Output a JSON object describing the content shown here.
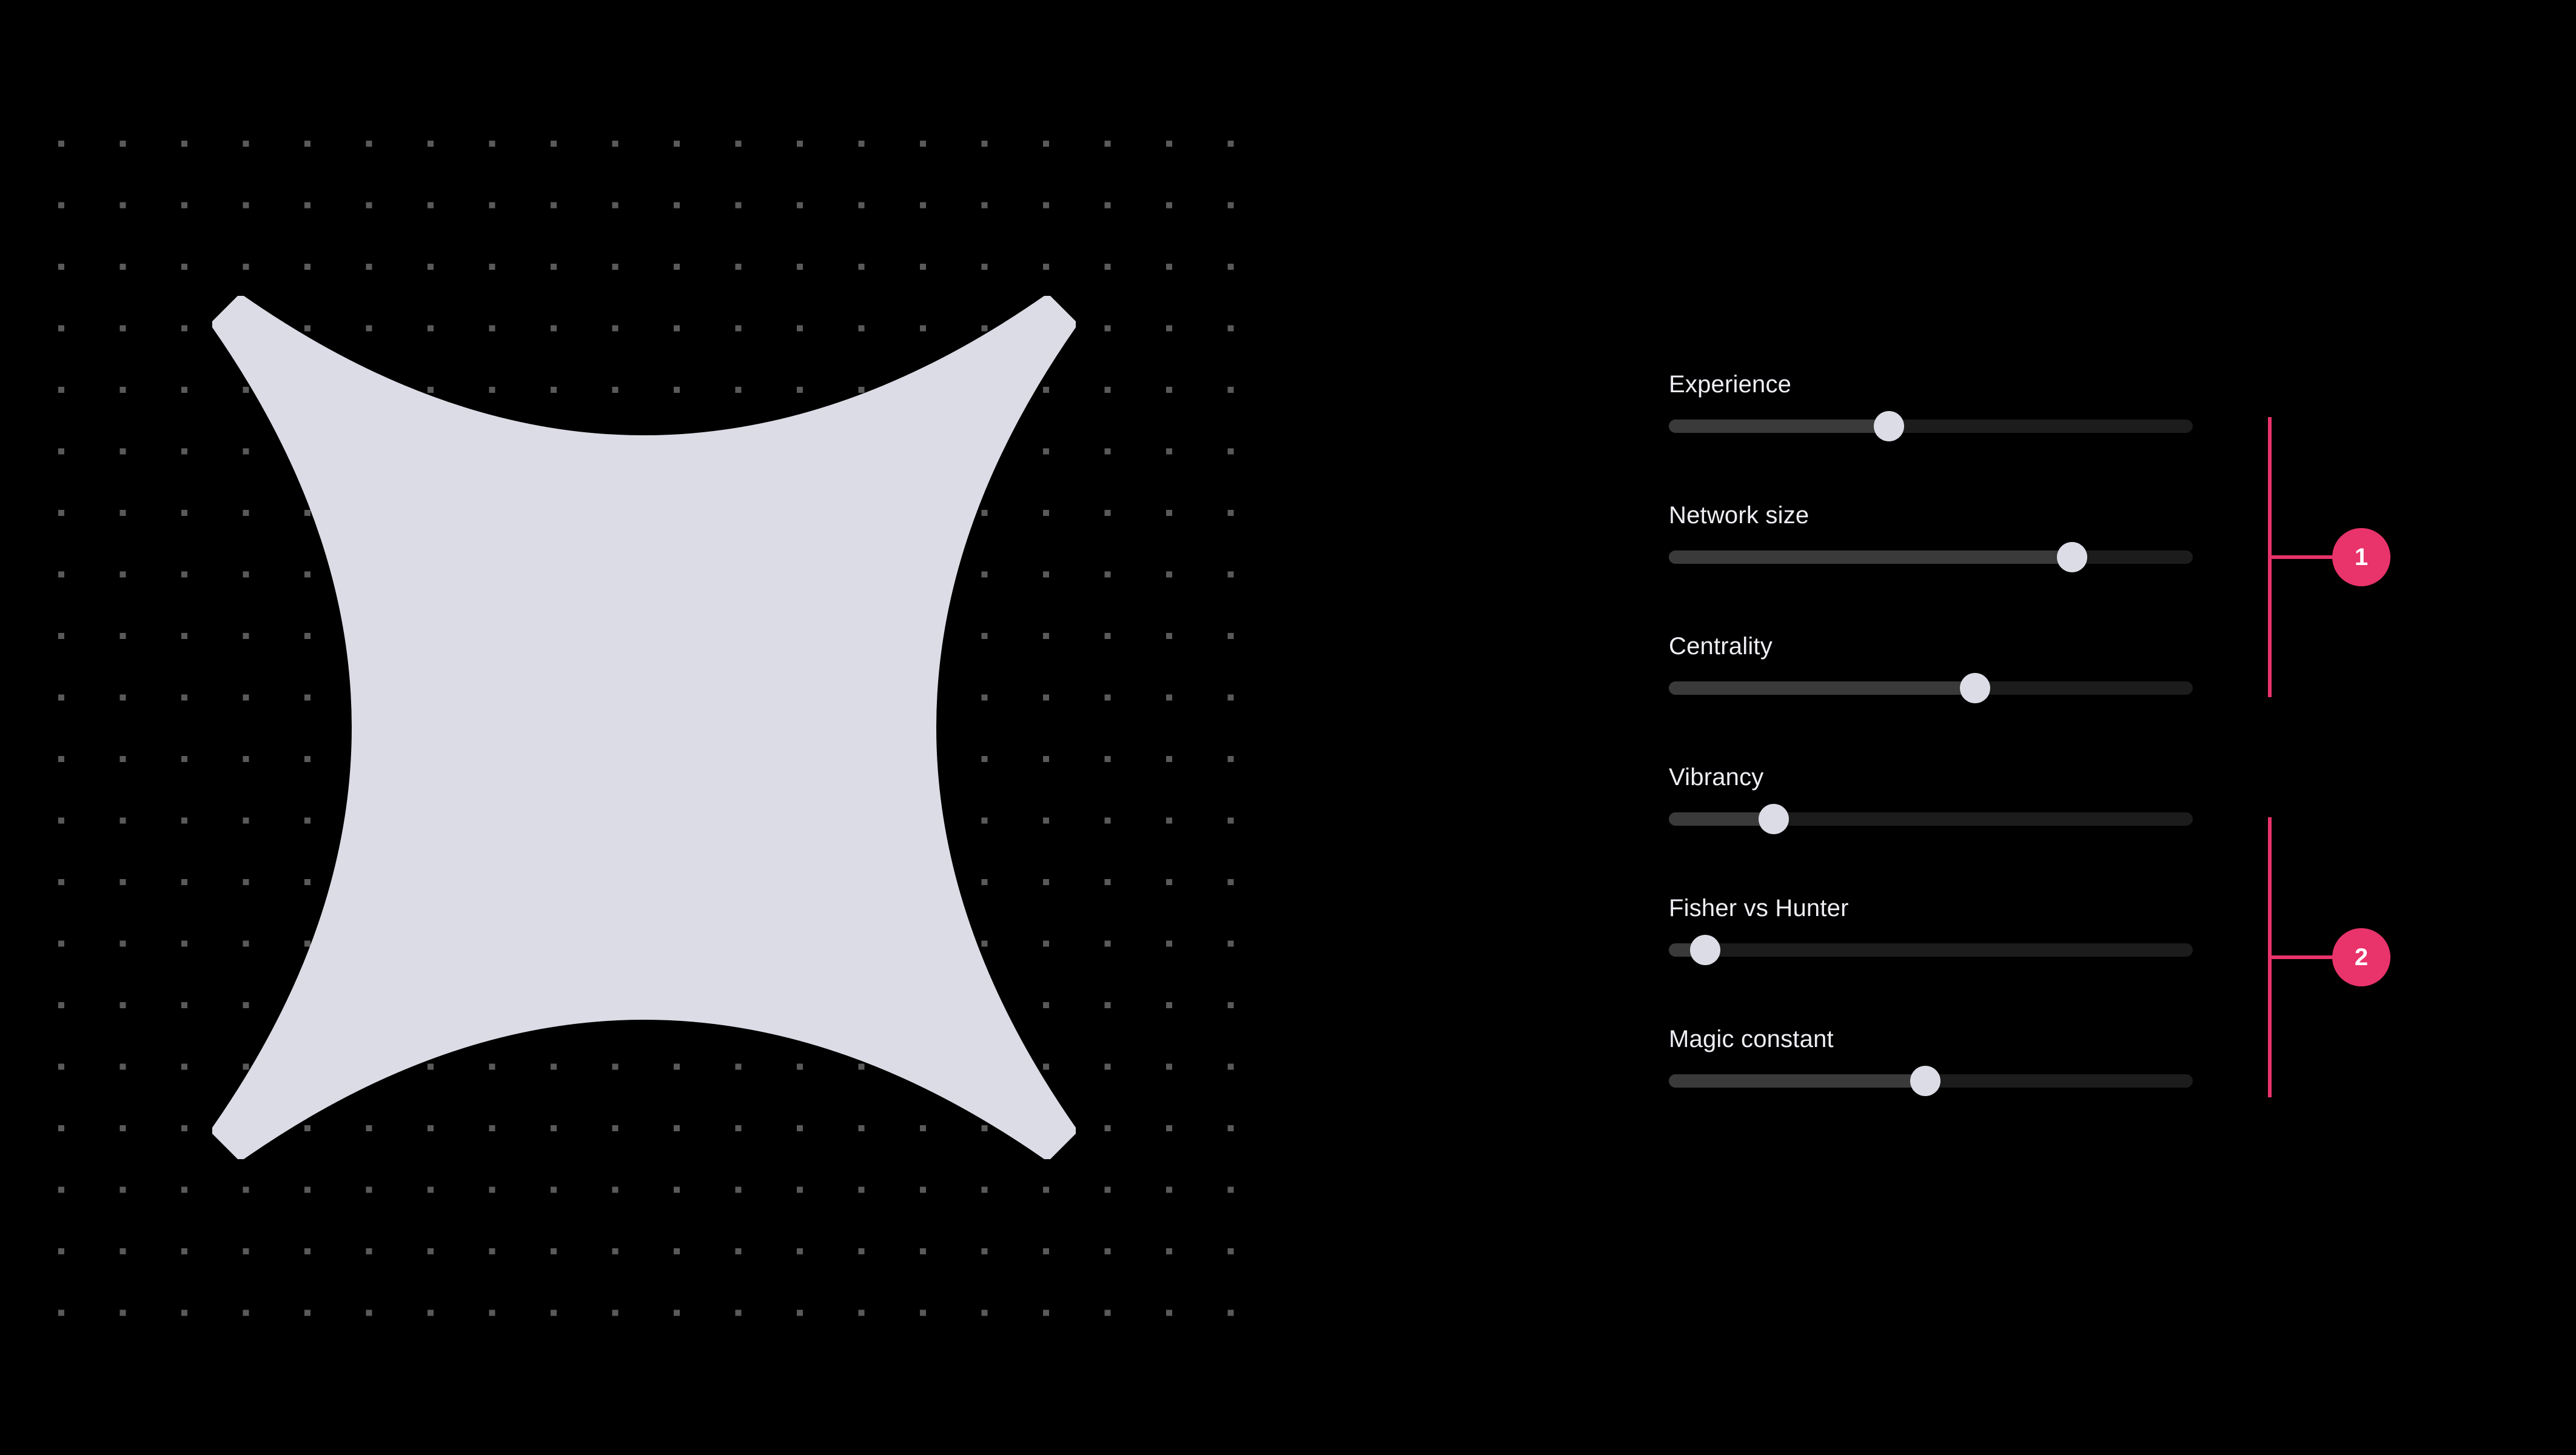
{
  "canvas": {
    "background": "#000000",
    "dot_color": "#5a5a5a",
    "shape_color": "#dcdce6",
    "shape_name": "four-point-star-shape"
  },
  "controls": {
    "sliders": [
      {
        "label": "Experience",
        "value": 0.42
      },
      {
        "label": "Network size",
        "value": 0.77
      },
      {
        "label": "Centrality",
        "value": 0.585
      },
      {
        "label": "Vibrancy",
        "value": 0.2
      },
      {
        "label": "Fisher vs Hunter",
        "value": 0.07
      },
      {
        "label": "Magic constant",
        "value": 0.49
      }
    ],
    "track_color": "#1c1c1c",
    "fill_color": "#3a3a3a",
    "thumb_color": "#dcdce6"
  },
  "annotations": {
    "color": "#e8336b",
    "groups": [
      {
        "badge": "1"
      },
      {
        "badge": "2"
      }
    ]
  }
}
